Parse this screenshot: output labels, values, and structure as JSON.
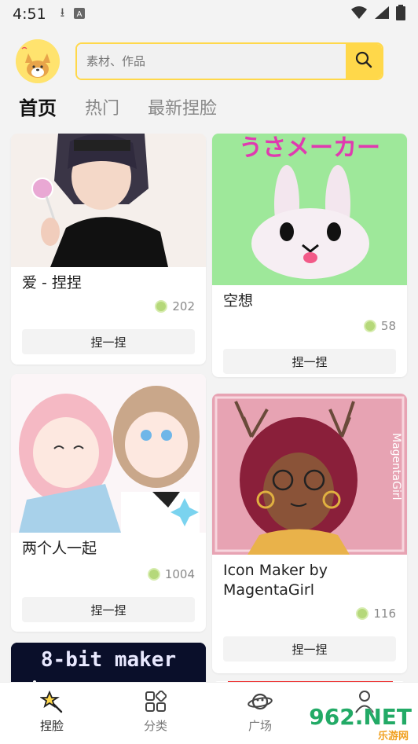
{
  "status_bar": {
    "time": "4:51"
  },
  "search": {
    "placeholder": "素材、作品"
  },
  "tabs": [
    {
      "label": "首页",
      "active": true
    },
    {
      "label": "热门",
      "active": false
    },
    {
      "label": "最新捏脸",
      "active": false
    }
  ],
  "cards": [
    {
      "title": "爱 - 捏捏",
      "count": "202",
      "button": "捏一捏"
    },
    {
      "title": "空想",
      "count": "58",
      "button": "捏一捏",
      "image_text": "うさメーカー"
    },
    {
      "title": "两个人一起",
      "count": "1004",
      "button": "捏一捏"
    },
    {
      "title": "Icon Maker by MagentaGirl",
      "count": "116",
      "button": "捏一捏",
      "image_text": "MagentaGirl"
    },
    {
      "title": "",
      "image_text": "8-bit maker"
    }
  ],
  "bottom_nav": [
    {
      "label": "捏脸",
      "icon": "star-wand-icon",
      "active": true
    },
    {
      "label": "分类",
      "icon": "grid-icon",
      "active": false
    },
    {
      "label": "广场",
      "icon": "planet-icon",
      "active": false
    },
    {
      "label": "",
      "icon": "person-icon",
      "active": false
    }
  ],
  "watermark": {
    "text": "962.NET",
    "sub": "乐游网"
  },
  "colors": {
    "accent": "#ffd84a",
    "coin": "#b5d87a"
  }
}
